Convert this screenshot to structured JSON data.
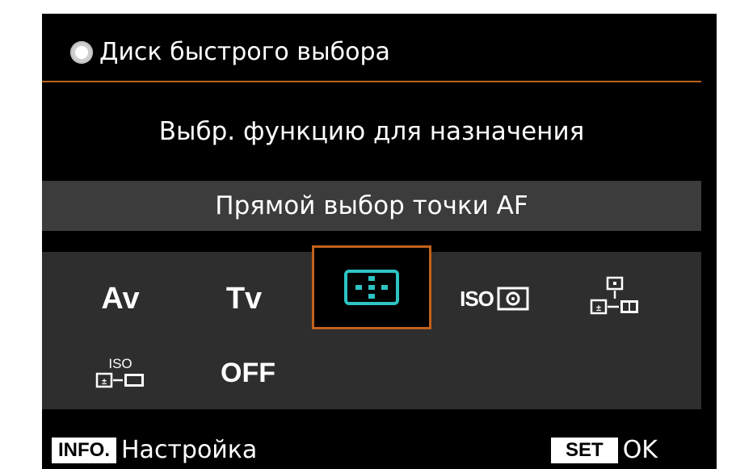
{
  "header": {
    "title": "Диск быстрого выбора",
    "icon": "dial-icon"
  },
  "subtitle": "Выбр. функцию для назначения",
  "selected_function": "Прямой выбор точки AF",
  "options": {
    "av": "Av",
    "tv": "Tv",
    "af_point": "af-point-select-icon",
    "iso": "ISO",
    "exposure_comp": "exposure-comp-icon",
    "iso_comp_label": "ISO",
    "off": "OFF",
    "selected": "af_point"
  },
  "footer": {
    "info_key": "INFO.",
    "info_label": "Настройка",
    "set_key": "SET",
    "set_label": "OK"
  },
  "colors": {
    "accent": "#c2611c",
    "rule": "#b8641f",
    "icon_cyan": "#2ec3c3",
    "panel": "#2e2e2e",
    "highlight": "#3c3c3c"
  }
}
